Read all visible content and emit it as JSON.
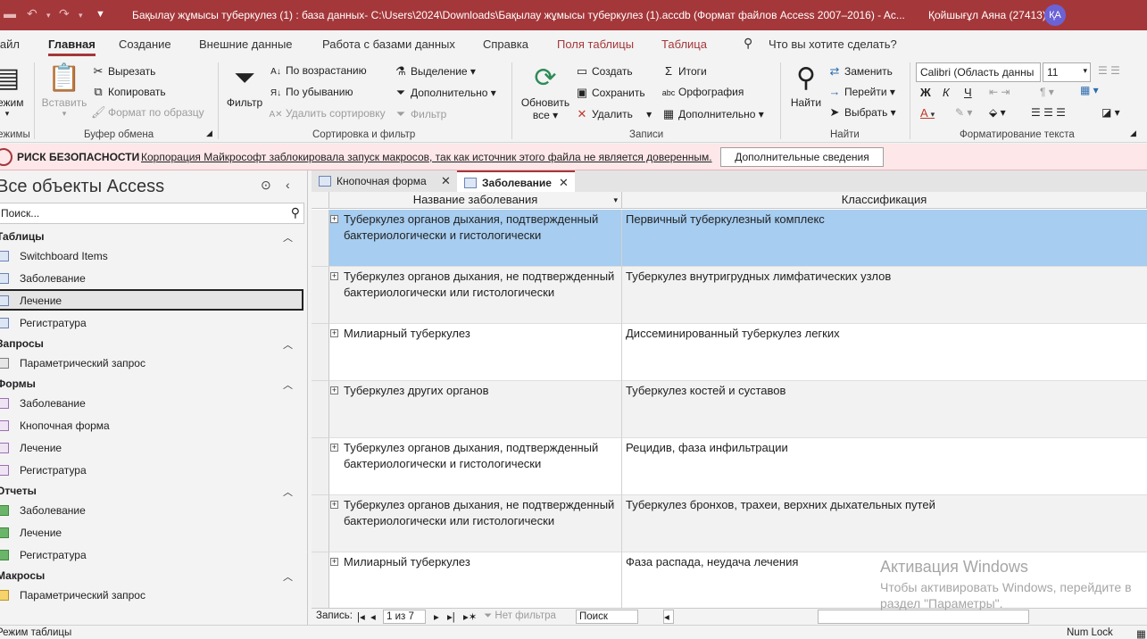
{
  "titlebar": {
    "title": "Бақылау жұмысы туберкулез (1) : база данных- C:\\Users\\2024\\Downloads\\Бақылау жұмысы туберкулез (1).accdb (Формат файлов Access 2007–2016)  -  Ac...",
    "user": "Қойшығұл Аяна (27413)",
    "avatar": "ҚА",
    "accent_color": "#a4373a"
  },
  "menu": {
    "file": "Файл",
    "home": "Главная",
    "create": "Создание",
    "external": "Внешние данные",
    "dbtools": "Работа с базами данных",
    "help": "Справка",
    "fields": "Поля таблицы",
    "table": "Таблица",
    "tell_me": "Что вы хотите сделать?"
  },
  "ribbon": {
    "views": {
      "label1": "Режим",
      "group": "Режимы"
    },
    "clipboard": {
      "paste": "Вставить",
      "cut": "Вырезать",
      "copy": "Копировать",
      "format_painter": "Формат по образцу",
      "group": "Буфер обмена"
    },
    "sort": {
      "filter": "Фильтр",
      "asc": "По возрастанию",
      "desc": "По убыванию",
      "remove_sort": "Удалить сортировку",
      "selection": "Выделение",
      "advanced": "Дополнительно",
      "toggle_filter": "Фильтр",
      "group": "Сортировка и фильтр"
    },
    "records": {
      "refresh1": "Обновить",
      "refresh2": "все",
      "new": "Создать",
      "save": "Сохранить",
      "delete": "Удалить",
      "totals": "Итоги",
      "spelling": "Орфография",
      "more": "Дополнительно",
      "group": "Записи"
    },
    "find": {
      "find": "Найти",
      "replace": "Заменить",
      "goto": "Перейти",
      "select": "Выбрать",
      "group": "Найти"
    },
    "text": {
      "font": "Calibri (Область данны",
      "size": "11",
      "group": "Форматирование текста"
    }
  },
  "security": {
    "risk": "РИСК БЕЗОПАСНОСТИ",
    "message": "Корпорация Майкрософт заблокировала запуск макросов, так как источник этого файла не является доверенным.",
    "button": "Дополнительные сведения"
  },
  "nav": {
    "title": "Все объекты Access",
    "search_placeholder": "Поиск...",
    "tables": {
      "label": "Таблицы",
      "items": [
        "Switchboard Items",
        "Заболевание",
        "Лечение",
        "Регистратура"
      ]
    },
    "queries": {
      "label": "Запросы",
      "items": [
        "Параметрический запрос"
      ]
    },
    "forms": {
      "label": "Формы",
      "items": [
        "Заболевание",
        "Кнопочная форма",
        "Лечение",
        "Регистратура"
      ]
    },
    "reports": {
      "label": "Отчеты",
      "items": [
        "Заболевание",
        "Лечение",
        "Регистратура"
      ]
    },
    "macros": {
      "label": "Макросы",
      "items": [
        "Параметрический запрос"
      ]
    }
  },
  "doctabs": [
    "Кнопочная форма",
    "Заболевание"
  ],
  "datasheet": {
    "columns": [
      "Название заболевания",
      "Классификация"
    ],
    "rows": [
      [
        "Туберкулез органов дыхания, подтвержденный бактериологически и гистологически",
        "Первичный туберкулезный комплекс"
      ],
      [
        "Туберкулез органов дыхания, не подтвержденный бактериологически или гистологически",
        "Туберкулез внутригрудных лимфатических узлов"
      ],
      [
        "Милиарный туберкулез",
        "Диссеминированный туберкулез легких"
      ],
      [
        "Туберкулез других органов",
        "Туберкулез костей и суставов"
      ],
      [
        "Туберкулез органов дыхания, подтвержденный бактериологически и гистологически",
        "Рецидив, фаза инфильтрации"
      ],
      [
        "Туберкулез органов дыхания, не подтвержденный бактериологически или гистологически",
        "Туберкулез бронхов, трахеи, верхних дыхательных путей"
      ],
      [
        "Милиарный туберкулез",
        "Фаза распада, неудача лечения"
      ]
    ],
    "selected_row_color": "#a7cdf0"
  },
  "recnav": {
    "label": "Запись:",
    "position": "1 из 7",
    "no_filter": "Нет фильтра",
    "search": "Поиск"
  },
  "watermark": {
    "line1": "Активация Windows",
    "line2": "Чтобы активировать Windows, перейдите в",
    "line3": "раздел \"Параметры\"."
  },
  "status": {
    "left": "Режим таблицы",
    "right": "Num Lock"
  }
}
